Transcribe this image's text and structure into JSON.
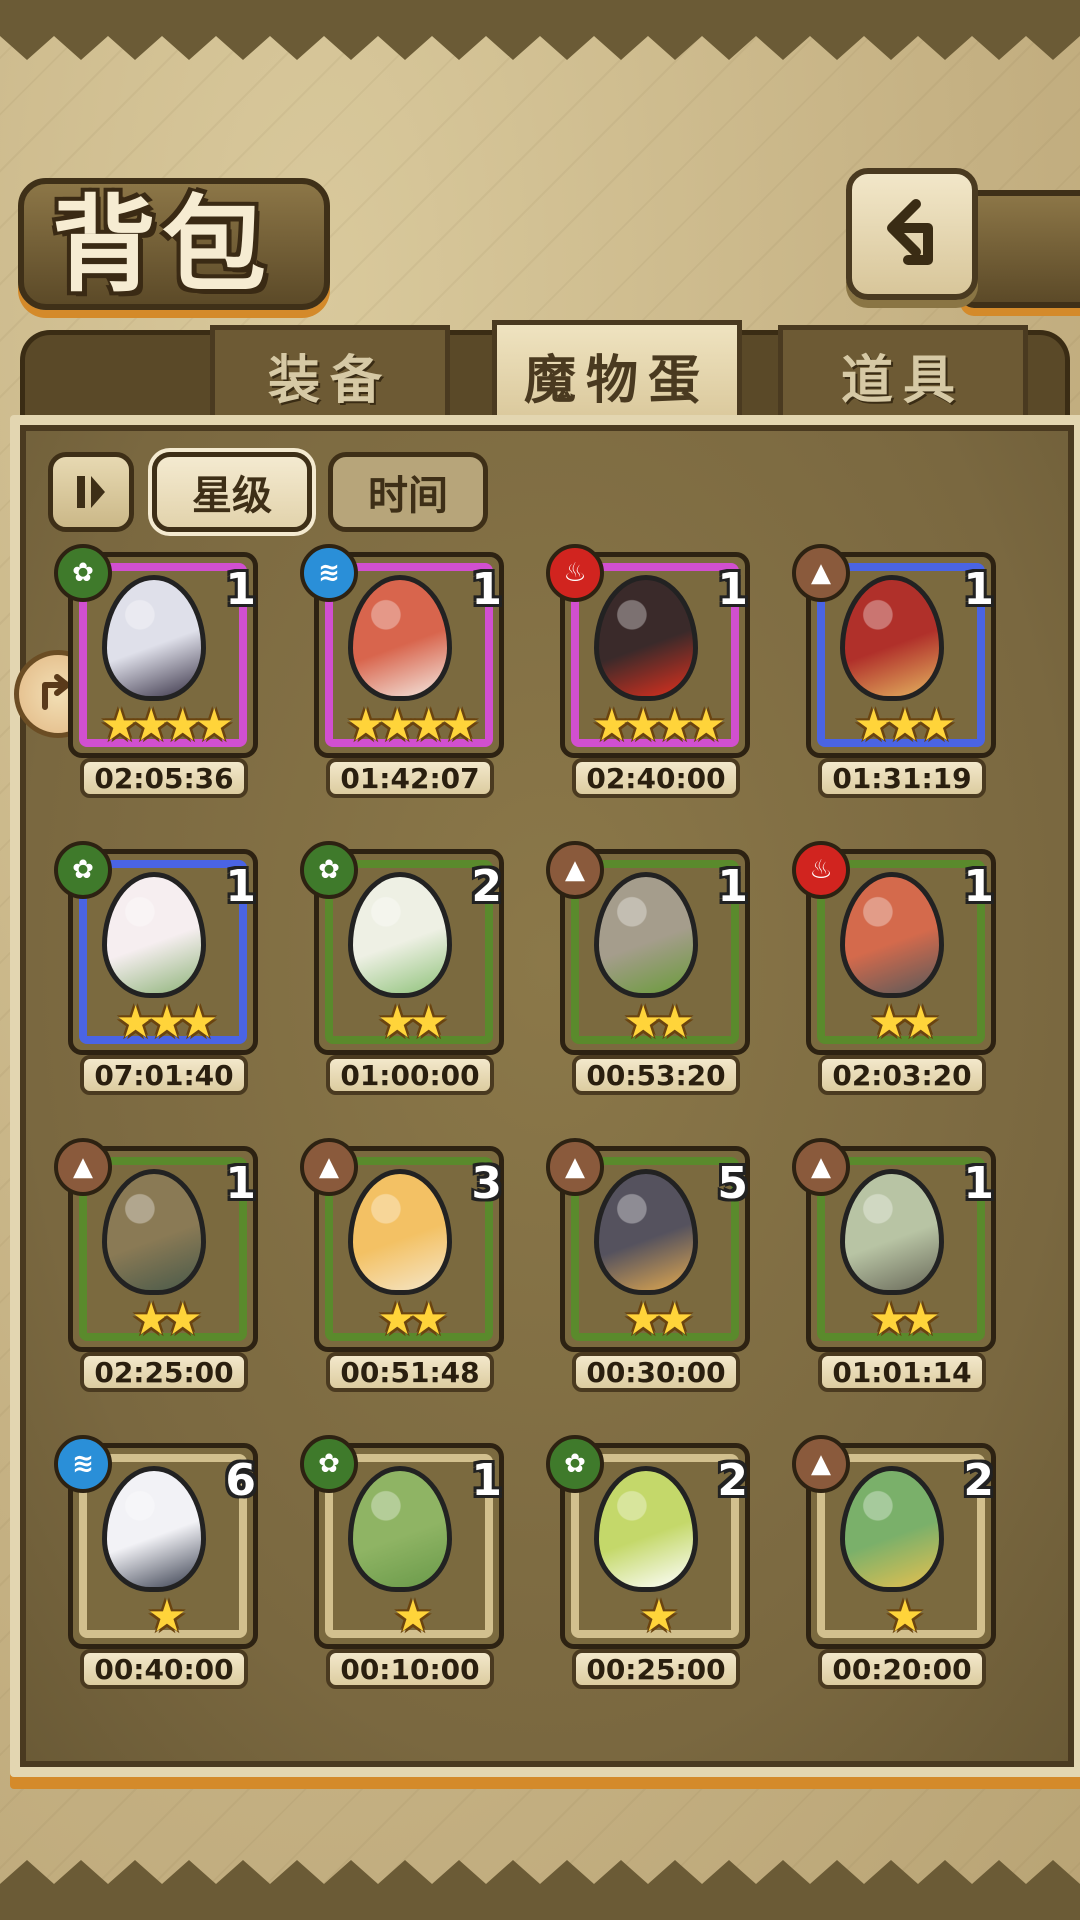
{
  "title": "背包",
  "tabs": [
    {
      "label": "装备",
      "active": false
    },
    {
      "label": "魔物蛋",
      "active": true
    },
    {
      "label": "道具",
      "active": false
    }
  ],
  "sort": {
    "toggle_icon": "sort-toggle-icon",
    "star_label": "星级",
    "time_label": "时间"
  },
  "back_icon": "back-arrow-icon",
  "side_icon": "side-arrow-icon",
  "rarity_colors": {
    "purple": "#d14fd0",
    "blue": "#4a64e4",
    "green": "#5a8a2c",
    "tan": "#d2c08e"
  },
  "element_colors": {
    "grass": "#3f7a2b",
    "water": "#2a8fd8",
    "fire": "#d1241f",
    "earth": "#8a5a3c"
  },
  "eggs": [
    {
      "element": "grass",
      "count": "1",
      "stars": 4,
      "rarity": "purple",
      "timer": "02:05:36",
      "egg_color": "#dfe0ea",
      "egg_accent": "#3a3448"
    },
    {
      "element": "water",
      "count": "1",
      "stars": 4,
      "rarity": "purple",
      "timer": "01:42:07",
      "egg_color": "#d8654d",
      "egg_accent": "#f4e8e0"
    },
    {
      "element": "fire",
      "count": "1",
      "stars": 4,
      "rarity": "purple",
      "timer": "02:40:00",
      "egg_color": "#3a2a2a",
      "egg_accent": "#e0301e"
    },
    {
      "element": "earth",
      "count": "1",
      "stars": 3,
      "rarity": "blue",
      "timer": "01:31:19",
      "egg_color": "#b0302a",
      "egg_accent": "#e4b460"
    },
    {
      "element": "grass",
      "count": "1",
      "stars": 3,
      "rarity": "blue",
      "timer": "07:01:40",
      "egg_color": "#f6eef0",
      "egg_accent": "#8fb47a"
    },
    {
      "element": "grass",
      "count": "2",
      "stars": 2,
      "rarity": "green",
      "timer": "01:00:00",
      "egg_color": "#eef0e4",
      "egg_accent": "#8fc27a"
    },
    {
      "element": "earth",
      "count": "1",
      "stars": 2,
      "rarity": "green",
      "timer": "00:53:20",
      "egg_color": "#a59d8c",
      "egg_accent": "#6a9b3a"
    },
    {
      "element": "fire",
      "count": "1",
      "stars": 2,
      "rarity": "green",
      "timer": "02:03:20",
      "egg_color": "#d46a4c",
      "egg_accent": "#5a5a5a"
    },
    {
      "element": "earth",
      "count": "1",
      "stars": 2,
      "rarity": "green",
      "timer": "02:25:00",
      "egg_color": "#8a7a55",
      "egg_accent": "#4a5a4a"
    },
    {
      "element": "earth",
      "count": "3",
      "stars": 2,
      "rarity": "green",
      "timer": "00:51:48",
      "egg_color": "#f3c164",
      "egg_accent": "#f5e6c8"
    },
    {
      "element": "earth",
      "count": "5",
      "stars": 2,
      "rarity": "green",
      "timer": "00:30:00",
      "egg_color": "#55525e",
      "egg_accent": "#e0a850"
    },
    {
      "element": "earth",
      "count": "1",
      "stars": 2,
      "rarity": "green",
      "timer": "01:01:14",
      "egg_color": "#b8c4a4",
      "egg_accent": "#6a6a5a"
    },
    {
      "element": "water",
      "count": "6",
      "stars": 1,
      "rarity": "tan",
      "timer": "00:40:00",
      "egg_color": "#f2f2f6",
      "egg_accent": "#3a4050"
    },
    {
      "element": "grass",
      "count": "1",
      "stars": 1,
      "rarity": "tan",
      "timer": "00:10:00",
      "egg_color": "#8fb464",
      "egg_accent": "#6a9a4a"
    },
    {
      "element": "grass",
      "count": "2",
      "stars": 1,
      "rarity": "tan",
      "timer": "00:25:00",
      "egg_color": "#c4d86a",
      "egg_accent": "#ffffff"
    },
    {
      "element": "earth",
      "count": "2",
      "stars": 1,
      "rarity": "tan",
      "timer": "00:20:00",
      "egg_color": "#7ab06a",
      "egg_accent": "#e6c050"
    }
  ]
}
